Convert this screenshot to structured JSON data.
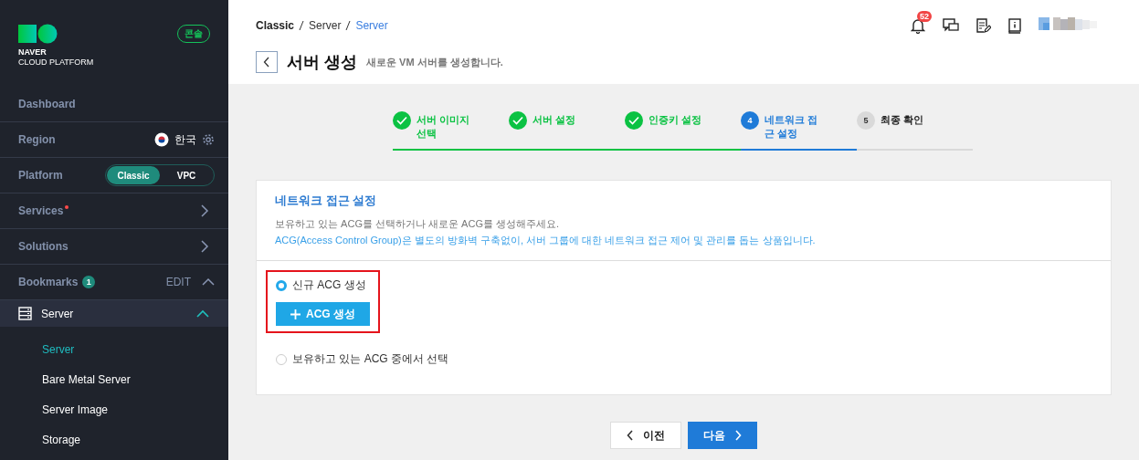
{
  "sidebar": {
    "console_badge": "콘솔",
    "brand": [
      "NAVER",
      "CLOUD PLATFORM"
    ],
    "rows": [
      {
        "kind": "plain",
        "label": "Dashboard"
      },
      {
        "kind": "region",
        "label": "Region",
        "value": "한국"
      },
      {
        "kind": "platform",
        "label": "Platform",
        "options": [
          {
            "label": "Classic",
            "selected": true
          },
          {
            "label": "VPC",
            "selected": false
          }
        ]
      },
      {
        "kind": "nav",
        "label": "Services",
        "new": true
      },
      {
        "kind": "nav",
        "label": "Solutions",
        "new": false
      },
      {
        "kind": "bookmarks",
        "label": "Bookmarks",
        "count": "1",
        "action": "EDIT"
      }
    ],
    "group": {
      "label": "Server",
      "expanded": true,
      "children": [
        {
          "label": "Server",
          "selected": true
        },
        {
          "label": "Bare Metal Server",
          "selected": false
        },
        {
          "label": "Server Image",
          "selected": false
        },
        {
          "label": "Storage",
          "selected": false
        }
      ]
    }
  },
  "breadcrumb": [
    "Classic",
    "Server",
    "Server"
  ],
  "header": {
    "notification_count": "52",
    "title": "서버 생성",
    "subtitle": "새로운 VM 서버를 생성합니다."
  },
  "steps": [
    {
      "label": "서버 이미지 선택",
      "done": true,
      "current": false
    },
    {
      "label": "서버 설정",
      "done": true,
      "current": false
    },
    {
      "label": "인증키 설정",
      "done": true,
      "current": false
    },
    {
      "number": "4",
      "label": "네트워크 접근 설정",
      "done": false,
      "current": true
    },
    {
      "number": "5",
      "label": "최종 확인",
      "done": false,
      "current": false
    }
  ],
  "section": {
    "title": "네트워크 접근 설정",
    "description": "보유하고 있는 ACG를 선택하거나 새로운 ACG를 생성해주세요.",
    "note": "ACG(Access Control Group)은 별도의 방화벽 구축없이, 서버 그룹에 대한 네트워크 접근 제어 및 관리를 돕는 상품입니다.",
    "options": [
      {
        "label": "신규 ACG 생성",
        "selected": true,
        "highlighted": true,
        "action": "ACG 생성"
      },
      {
        "label": "보유하고 있는 ACG 중에서 선택",
        "selected": false,
        "highlighted": false
      }
    ]
  },
  "footer": {
    "prev": "이전",
    "next": "다음"
  }
}
